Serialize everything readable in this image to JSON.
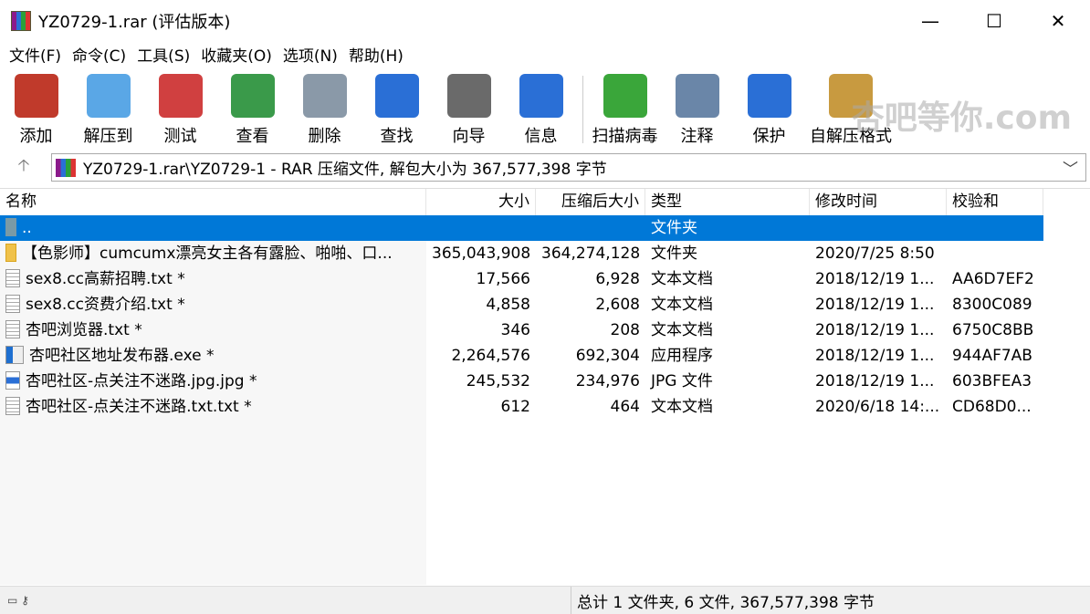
{
  "window": {
    "title": "YZ0729-1.rar (评估版本)",
    "minimize": "—",
    "maximize": "☐",
    "close": "✕"
  },
  "menu": [
    "文件(F)",
    "命令(C)",
    "工具(S)",
    "收藏夹(O)",
    "选项(N)",
    "帮助(H)"
  ],
  "toolbar": [
    {
      "label": "添加",
      "icon": "add-icon",
      "color": "#c03a2b"
    },
    {
      "label": "解压到",
      "icon": "extract-folder-icon",
      "color": "#5aa7e6"
    },
    {
      "label": "测试",
      "icon": "test-checklist-icon",
      "color": "#d04040"
    },
    {
      "label": "查看",
      "icon": "book-icon",
      "color": "#3a9a4a"
    },
    {
      "label": "删除",
      "icon": "trash-icon",
      "color": "#8a99a8"
    },
    {
      "label": "查找",
      "icon": "magnifier-icon",
      "color": "#2a6fd6"
    },
    {
      "label": "向导",
      "icon": "wand-icon",
      "color": "#6a6a6a"
    },
    {
      "label": "信息",
      "icon": "info-icon",
      "color": "#2a6fd6"
    },
    {
      "label": "扫描病毒",
      "icon": "virus-scan-icon",
      "color": "#3aa63a"
    },
    {
      "label": "注释",
      "icon": "comment-icon",
      "color": "#6a86a8"
    },
    {
      "label": "保护",
      "icon": "shield-icon",
      "color": "#2a6fd6"
    },
    {
      "label": "自解压格式",
      "icon": "sfx-icon",
      "color": "#c89a40"
    }
  ],
  "watermark": "杏吧等你.com",
  "address": {
    "path": "YZ0729-1.rar\\YZ0729-1 - RAR 压缩文件, 解包大小为 367,577,398 字节"
  },
  "columns": [
    "名称",
    "大小",
    "压缩后大小",
    "类型",
    "修改时间",
    "校验和"
  ],
  "rows": [
    {
      "name": "..",
      "size": "",
      "packed": "",
      "type": "文件夹",
      "mtime": "",
      "crc": "",
      "icon": "up"
    },
    {
      "name": "【色影师】cumcumx漂亮女主各有露脸、啪啪、口...",
      "size": "365,043,908",
      "packed": "364,274,128",
      "type": "文件夹",
      "mtime": "2020/7/25 8:50",
      "crc": "",
      "icon": "folder"
    },
    {
      "name": "sex8.cc高薪招聘.txt *",
      "size": "17,566",
      "packed": "6,928",
      "type": "文本文档",
      "mtime": "2018/12/19 1...",
      "crc": "AA6D7EF2",
      "icon": "txt"
    },
    {
      "name": "sex8.cc资费介绍.txt *",
      "size": "4,858",
      "packed": "2,608",
      "type": "文本文档",
      "mtime": "2018/12/19 1...",
      "crc": "8300C089",
      "icon": "txt"
    },
    {
      "name": "杏吧浏览器.txt *",
      "size": "346",
      "packed": "208",
      "type": "文本文档",
      "mtime": "2018/12/19 1...",
      "crc": "6750C8BB",
      "icon": "txt"
    },
    {
      "name": "杏吧社区地址发布器.exe *",
      "size": "2,264,576",
      "packed": "692,304",
      "type": "应用程序",
      "mtime": "2018/12/19 1...",
      "crc": "944AF7AB",
      "icon": "exe"
    },
    {
      "name": "杏吧社区-点关注不迷路.jpg.jpg *",
      "size": "245,532",
      "packed": "234,976",
      "type": "JPG 文件",
      "mtime": "2018/12/19 1...",
      "crc": "603BFEA3",
      "icon": "jpg"
    },
    {
      "name": "杏吧社区-点关注不迷路.txt.txt *",
      "size": "612",
      "packed": "464",
      "type": "文本文档",
      "mtime": "2020/6/18 14:...",
      "crc": "CD68D0...",
      "icon": "txt"
    }
  ],
  "status": {
    "summary": "总计 1 文件夹, 6 文件, 367,577,398 字节"
  }
}
